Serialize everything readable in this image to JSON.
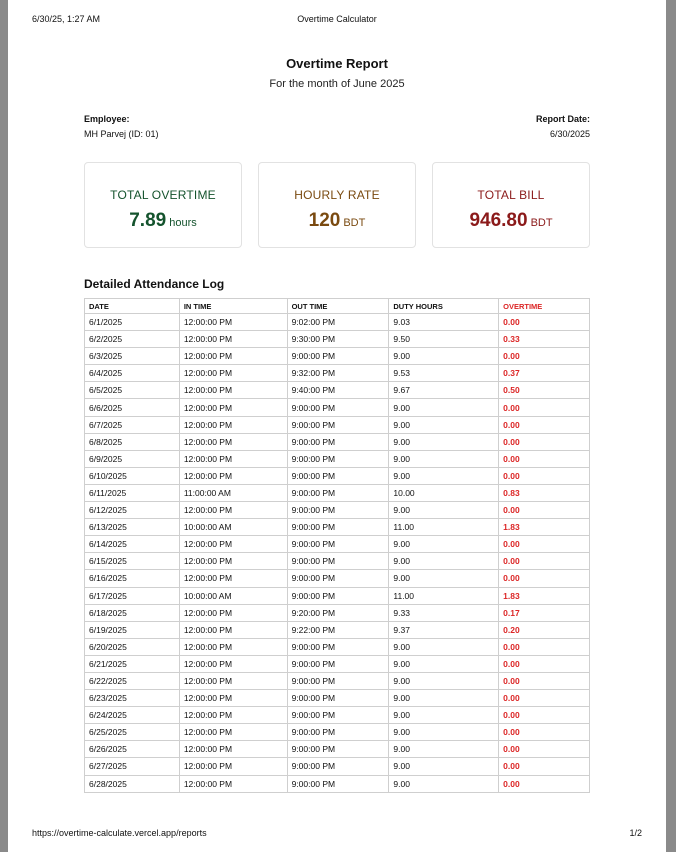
{
  "print_header": {
    "datetime": "6/30/25, 1:27 AM",
    "app_title": "Overtime Calculator"
  },
  "print_footer": {
    "url": "https://overtime-calculate.vercel.app/reports",
    "page": "1/2"
  },
  "report": {
    "title": "Overtime Report",
    "subtitle": "For the month of June 2025",
    "employee_label": "Employee:",
    "employee_value": "MH Parvej (ID: 01)",
    "report_date_label": "Report Date:",
    "report_date_value": "6/30/2025"
  },
  "summary": {
    "total_overtime": {
      "label": "TOTAL OVERTIME",
      "value": "7.89",
      "unit": "hours",
      "color": "#14532d"
    },
    "hourly_rate": {
      "label": "HOURLY RATE",
      "value": "120",
      "unit": "BDT",
      "color": "#7a4a10"
    },
    "total_bill": {
      "label": "TOTAL BILL",
      "value": "946.80",
      "unit": "BDT",
      "color": "#8b1a1a"
    }
  },
  "log": {
    "title": "Detailed Attendance Log",
    "columns": [
      "DATE",
      "IN TIME",
      "OUT TIME",
      "DUTY HOURS",
      "OVERTIME"
    ],
    "rows": [
      [
        "6/1/2025",
        "12:00:00 PM",
        "9:02:00 PM",
        "9.03",
        "0.00"
      ],
      [
        "6/2/2025",
        "12:00:00 PM",
        "9:30:00 PM",
        "9.50",
        "0.33"
      ],
      [
        "6/3/2025",
        "12:00:00 PM",
        "9:00:00 PM",
        "9.00",
        "0.00"
      ],
      [
        "6/4/2025",
        "12:00:00 PM",
        "9:32:00 PM",
        "9.53",
        "0.37"
      ],
      [
        "6/5/2025",
        "12:00:00 PM",
        "9:40:00 PM",
        "9.67",
        "0.50"
      ],
      [
        "6/6/2025",
        "12:00:00 PM",
        "9:00:00 PM",
        "9.00",
        "0.00"
      ],
      [
        "6/7/2025",
        "12:00:00 PM",
        "9:00:00 PM",
        "9.00",
        "0.00"
      ],
      [
        "6/8/2025",
        "12:00:00 PM",
        "9:00:00 PM",
        "9.00",
        "0.00"
      ],
      [
        "6/9/2025",
        "12:00:00 PM",
        "9:00:00 PM",
        "9.00",
        "0.00"
      ],
      [
        "6/10/2025",
        "12:00:00 PM",
        "9:00:00 PM",
        "9.00",
        "0.00"
      ],
      [
        "6/11/2025",
        "11:00:00 AM",
        "9:00:00 PM",
        "10.00",
        "0.83"
      ],
      [
        "6/12/2025",
        "12:00:00 PM",
        "9:00:00 PM",
        "9.00",
        "0.00"
      ],
      [
        "6/13/2025",
        "10:00:00 AM",
        "9:00:00 PM",
        "11.00",
        "1.83"
      ],
      [
        "6/14/2025",
        "12:00:00 PM",
        "9:00:00 PM",
        "9.00",
        "0.00"
      ],
      [
        "6/15/2025",
        "12:00:00 PM",
        "9:00:00 PM",
        "9.00",
        "0.00"
      ],
      [
        "6/16/2025",
        "12:00:00 PM",
        "9:00:00 PM",
        "9.00",
        "0.00"
      ],
      [
        "6/17/2025",
        "10:00:00 AM",
        "9:00:00 PM",
        "11.00",
        "1.83"
      ],
      [
        "6/18/2025",
        "12:00:00 PM",
        "9:20:00 PM",
        "9.33",
        "0.17"
      ],
      [
        "6/19/2025",
        "12:00:00 PM",
        "9:22:00 PM",
        "9.37",
        "0.20"
      ],
      [
        "6/20/2025",
        "12:00:00 PM",
        "9:00:00 PM",
        "9.00",
        "0.00"
      ],
      [
        "6/21/2025",
        "12:00:00 PM",
        "9:00:00 PM",
        "9.00",
        "0.00"
      ],
      [
        "6/22/2025",
        "12:00:00 PM",
        "9:00:00 PM",
        "9.00",
        "0.00"
      ],
      [
        "6/23/2025",
        "12:00:00 PM",
        "9:00:00 PM",
        "9.00",
        "0.00"
      ],
      [
        "6/24/2025",
        "12:00:00 PM",
        "9:00:00 PM",
        "9.00",
        "0.00"
      ],
      [
        "6/25/2025",
        "12:00:00 PM",
        "9:00:00 PM",
        "9.00",
        "0.00"
      ],
      [
        "6/26/2025",
        "12:00:00 PM",
        "9:00:00 PM",
        "9.00",
        "0.00"
      ],
      [
        "6/27/2025",
        "12:00:00 PM",
        "9:00:00 PM",
        "9.00",
        "0.00"
      ],
      [
        "6/28/2025",
        "12:00:00 PM",
        "9:00:00 PM",
        "9.00",
        "0.00"
      ]
    ]
  }
}
